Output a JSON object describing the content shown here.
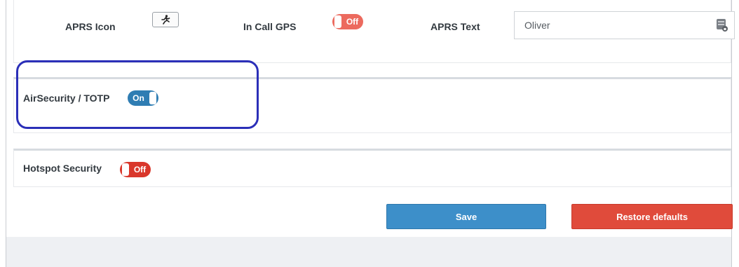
{
  "aprs": {
    "icon_label": "APRS Icon",
    "icon_name": "running-person-icon",
    "in_call_gps_label": "In Call GPS",
    "in_call_gps_state": "Off",
    "text_label": "APRS Text",
    "text_value": "Oliver"
  },
  "airsecurity": {
    "label": "AirSecurity / TOTP",
    "state": "On"
  },
  "hotspot": {
    "label": "Hotspot Security",
    "state": "Off"
  },
  "actions": {
    "save_label": "Save",
    "restore_label": "Restore defaults"
  },
  "colors": {
    "primary": "#3d8fc9",
    "danger": "#e04b3b",
    "toggle_on": "#2f7db3",
    "toggle_off": "#d9372b",
    "highlight": "#2b2fb8"
  }
}
